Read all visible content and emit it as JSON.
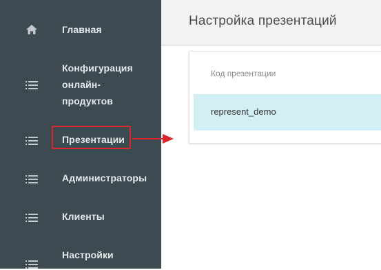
{
  "sidebar": {
    "items": [
      {
        "label": "Главная",
        "icon": "home-icon"
      },
      {
        "label": "Конфигурация\nонлайн-\nпродуктов",
        "icon": "list-icon"
      },
      {
        "label": "Презентации",
        "icon": "list-icon"
      },
      {
        "label": "Администраторы",
        "icon": "list-icon"
      },
      {
        "label": "Клиенты",
        "icon": "list-icon"
      },
      {
        "label": "Настройки",
        "icon": "list-icon"
      }
    ],
    "highlighted_item": "Презентации"
  },
  "header": {
    "title": "Настройка презентаций"
  },
  "table": {
    "columns": [
      "Код презентации"
    ],
    "rows": [
      [
        "represent_demo"
      ]
    ]
  },
  "colors": {
    "sidebar_bg": "#3e4a51",
    "selected_row_bg": "#d1eff4",
    "annotation_red": "#d9252c"
  }
}
